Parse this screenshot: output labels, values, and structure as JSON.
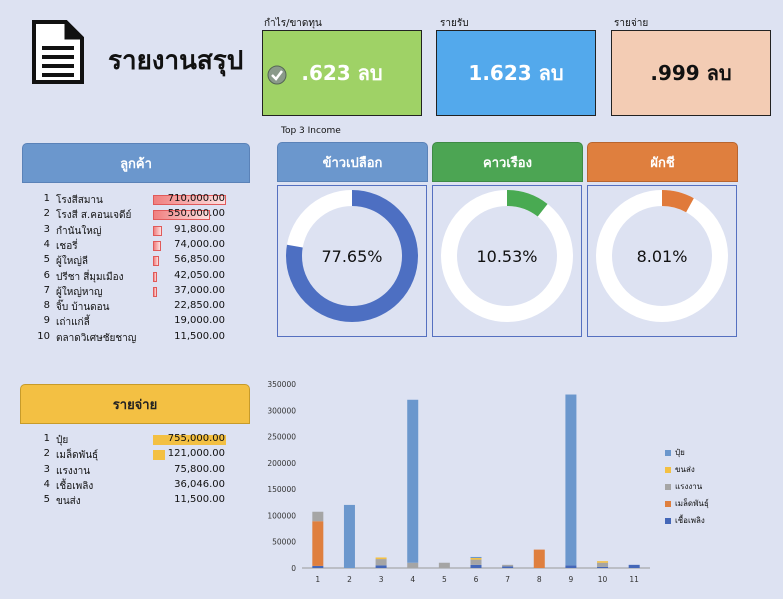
{
  "report": {
    "title": "รายงานสรุป"
  },
  "kpis": {
    "profit": {
      "caption": "กำไร/ขาดทุน",
      "value": ".623 ลบ",
      "color": "#9fd266"
    },
    "income": {
      "caption": "รายรับ",
      "value": "1.623 ลบ",
      "color": "#53a9ec"
    },
    "expense": {
      "caption": "รายจ่าย",
      "value": ".999 ลบ",
      "color": "#f3ccb4"
    }
  },
  "top3": {
    "title": "Top 3 Income",
    "items": [
      {
        "label": "ข้าวเปลือก",
        "percent_text": "77.65%",
        "percent": 77.65,
        "color": "#6b97cd",
        "ring_color": "#4d6fc2"
      },
      {
        "label": "คาวเรือง",
        "percent_text": "10.53%",
        "percent": 10.53,
        "color": "#4ca553",
        "ring_color": "#49aa52"
      },
      {
        "label": "ผักชี",
        "percent_text": "8.01%",
        "percent": 8.01,
        "color": "#df7f3e",
        "ring_color": "#e07a3a"
      }
    ]
  },
  "customers": {
    "title": "ลูกค้า",
    "rows": [
      {
        "rank": "1",
        "name": "โรงสีสมาน",
        "value": "710,000.00",
        "amount": 710000
      },
      {
        "rank": "2",
        "name": "โรงสี ส.คอนเจดีย์",
        "value": "550,000.00",
        "amount": 550000
      },
      {
        "rank": "3",
        "name": "กำนันใหญ่",
        "value": "91,800.00",
        "amount": 91800
      },
      {
        "rank": "4",
        "name": "เชอรี่",
        "value": "74,000.00",
        "amount": 74000
      },
      {
        "rank": "5",
        "name": "ผู้ใหญ่ลี",
        "value": "56,850.00",
        "amount": 56850
      },
      {
        "rank": "6",
        "name": "ปรีชา สี่มุมเมือง",
        "value": "42,050.00",
        "amount": 42050
      },
      {
        "rank": "7",
        "name": "ผู้ใหญ่หาญ",
        "value": "37,000.00",
        "amount": 37000
      },
      {
        "rank": "8",
        "name": "จิ๊บ บ้านดอน",
        "value": "22,850.00",
        "amount": 22850
      },
      {
        "rank": "9",
        "name": "เถ่าแก่ลี้",
        "value": "19,000.00",
        "amount": 19000
      },
      {
        "rank": "10",
        "name": "ตลาดวิเศษชัยชาญ",
        "value": "11,500.00",
        "amount": 11500
      }
    ]
  },
  "expenses": {
    "title": "รายจ่าย",
    "rows": [
      {
        "rank": "1",
        "name": "ปุ๋ย",
        "value": "755,000.00",
        "amount": 755000
      },
      {
        "rank": "2",
        "name": "เมล็ดพันธุ์",
        "value": "121,000.00",
        "amount": 121000
      },
      {
        "rank": "3",
        "name": "แรงงาน",
        "value": "75,800.00",
        "amount": 75800
      },
      {
        "rank": "4",
        "name": "เชื้อเพลิง",
        "value": "36,046.00",
        "amount": 36046
      },
      {
        "rank": "5",
        "name": "ขนส่ง",
        "value": "11,500.00",
        "amount": 11500
      }
    ]
  },
  "chart_data": {
    "type": "bar",
    "stacked": true,
    "categories": [
      "1",
      "2",
      "3",
      "4",
      "5",
      "6",
      "7",
      "8",
      "9",
      "10",
      "11"
    ],
    "ylim": [
      0,
      350000
    ],
    "yticks": [
      "0",
      "50000",
      "100000",
      "150000",
      "200000",
      "250000",
      "300000",
      "350000"
    ],
    "series": [
      {
        "name": "เชื้อเพลิง",
        "color": "#4467b8",
        "values": [
          4000,
          0,
          5000,
          0,
          0,
          6000,
          3000,
          0,
          5000,
          2000,
          6000
        ]
      },
      {
        "name": "เมล็ดพันธุ์",
        "color": "#df7f3e",
        "values": [
          85000,
          0,
          0,
          0,
          0,
          0,
          0,
          35000,
          0,
          0,
          0
        ]
      },
      {
        "name": "แรงงาน",
        "color": "#a5a5a5",
        "values": [
          18000,
          0,
          12000,
          10000,
          10000,
          10000,
          3000,
          0,
          0,
          8000,
          0
        ]
      },
      {
        "name": "ขนส่ง",
        "color": "#f3c043",
        "values": [
          0,
          0,
          3000,
          0,
          0,
          3000,
          0,
          0,
          0,
          3000,
          0
        ]
      },
      {
        "name": "ปุ๋ย",
        "color": "#6b97cd",
        "values": [
          0,
          120000,
          0,
          310000,
          0,
          2000,
          0,
          0,
          325000,
          0,
          0
        ]
      }
    ],
    "legend_order": [
      "ปุ๋ย",
      "ขนส่ง",
      "แรงงาน",
      "เมล็ดพันธุ์",
      "เชื้อเพลิง"
    ],
    "legend_position": "right"
  }
}
